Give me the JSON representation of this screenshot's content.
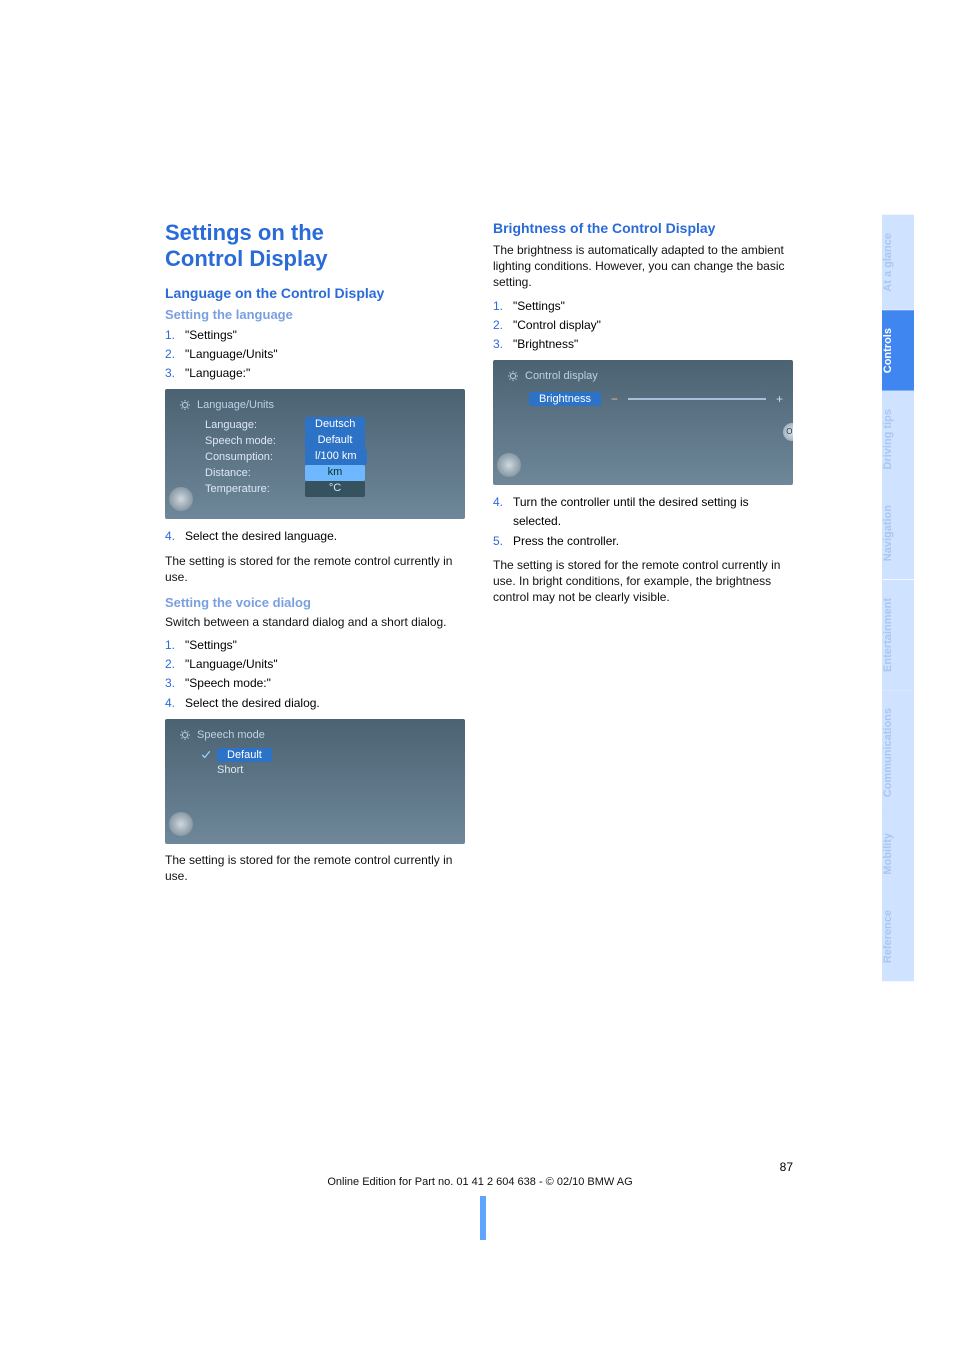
{
  "left": {
    "title1": "Settings on the",
    "title2": "Control Display",
    "langSection": "Language on the Control Display",
    "setLang": "Setting the language",
    "langSteps": [
      "\"Settings\"",
      "\"Language/Units\"",
      "\"Language:\""
    ],
    "ss1": {
      "title": "Language/Units",
      "rows": [
        {
          "label": "Language:",
          "val": "Deutsch",
          "sel": true
        },
        {
          "label": "Speech mode:",
          "val": "Default"
        },
        {
          "label": "Consumption:",
          "val": "l/100 km"
        },
        {
          "label": "Distance:",
          "val": "km",
          "hl": true
        },
        {
          "label": "Temperature:",
          "val": "°C"
        }
      ]
    },
    "step4": "Select the desired language.",
    "storedNote": "The setting is stored for the remote control currently in use.",
    "voiceTitle": "Setting the voice dialog",
    "voiceIntro": "Switch between a standard dialog and a short dialog.",
    "voiceSteps": [
      "\"Settings\"",
      "\"Language/Units\"",
      "\"Speech mode:\"",
      "Select the desired dialog."
    ],
    "ss2": {
      "title": "Speech mode",
      "opts": [
        "Default",
        "Short"
      ]
    },
    "storedNote2": "The setting is stored for the remote control currently in use."
  },
  "right": {
    "brightTitle": "Brightness of the Control Display",
    "brightIntro": "The brightness is automatically adapted to the ambient lighting conditions. However, you can change the basic setting.",
    "brightSteps": [
      "\"Settings\"",
      "\"Control display\"",
      "\"Brightness\""
    ],
    "ss3": {
      "title": "Control display",
      "slider": "Brightness"
    },
    "step4": "Turn the controller until the desired setting is selected.",
    "step5": "Press the controller.",
    "brightNote": "The setting is stored for the remote control currently in use. In bright conditions, for example, the brightness control may not be clearly visible."
  },
  "footer": {
    "page": "87",
    "edition": "Online Edition for Part no. 01 41 2 604 638 - © 02/10 BMW AG"
  },
  "tabs": [
    "At a glance",
    "Controls",
    "Driving tips",
    "Navigation",
    "Entertainment",
    "Communications",
    "Mobility",
    "Reference"
  ],
  "nums": {
    "n1": "1.",
    "n2": "2.",
    "n3": "3.",
    "n4": "4.",
    "n5": "5."
  }
}
